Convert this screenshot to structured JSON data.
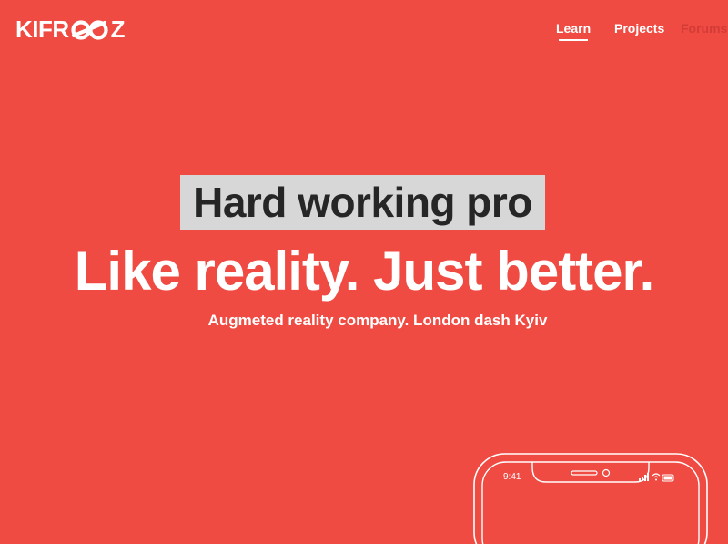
{
  "brand": {
    "logo_prefix": "KIFR",
    "logo_suffix": "Z",
    "logo_mark_icon": "double-loop-logo-icon",
    "color_primary": "#ef4b43",
    "color_white": "#ffffff"
  },
  "nav": {
    "items": [
      {
        "label": "Learn",
        "active": true
      },
      {
        "label": "Projects",
        "active": false
      },
      {
        "label": "Forums",
        "active": false
      }
    ]
  },
  "hero": {
    "badge_text": "Hard working pro",
    "headline": "Like reality. Just better.",
    "subtitle": "Augmeted reality company. London dash Kyiv"
  },
  "phone": {
    "time": "9:41",
    "status_icons": [
      "signal-icon",
      "wifi-icon",
      "battery-icon"
    ]
  }
}
